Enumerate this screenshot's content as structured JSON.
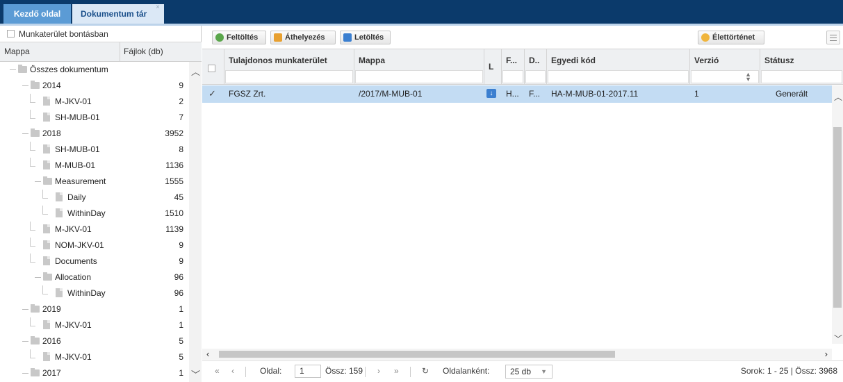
{
  "tabs": {
    "home": "Kezdő oldal",
    "docs": "Dokumentum tár",
    "close_glyph": "×"
  },
  "workspace_toggle": {
    "label": "Munkaterület bontásban",
    "checked": false
  },
  "tree": {
    "col_folder": "Mappa",
    "col_files": "Fájlok (db)",
    "rows": [
      {
        "label": "Összes dokumentum",
        "count": "",
        "type": "folder",
        "depth": 0
      },
      {
        "label": "2014",
        "count": "9",
        "type": "folder",
        "depth": 1
      },
      {
        "label": "M-JKV-01",
        "count": "2",
        "type": "file",
        "depth": 2
      },
      {
        "label": "SH-MUB-01",
        "count": "7",
        "type": "file",
        "depth": 2
      },
      {
        "label": "2018",
        "count": "3952",
        "type": "folder",
        "depth": 1
      },
      {
        "label": "SH-MUB-01",
        "count": "8",
        "type": "file",
        "depth": 2
      },
      {
        "label": "M-MUB-01",
        "count": "1136",
        "type": "file",
        "depth": 2
      },
      {
        "label": "Measurement",
        "count": "1555",
        "type": "folder",
        "depth": 2
      },
      {
        "label": "Daily",
        "count": "45",
        "type": "file",
        "depth": 3
      },
      {
        "label": "WithinDay",
        "count": "1510",
        "type": "file",
        "depth": 3
      },
      {
        "label": "M-JKV-01",
        "count": "1139",
        "type": "file",
        "depth": 2
      },
      {
        "label": "NOM-JKV-01",
        "count": "9",
        "type": "file",
        "depth": 2
      },
      {
        "label": "Documents",
        "count": "9",
        "type": "file",
        "depth": 2
      },
      {
        "label": "Allocation",
        "count": "96",
        "type": "folder",
        "depth": 2
      },
      {
        "label": "WithinDay",
        "count": "96",
        "type": "file",
        "depth": 3
      },
      {
        "label": "2019",
        "count": "1",
        "type": "folder",
        "depth": 1
      },
      {
        "label": "M-JKV-01",
        "count": "1",
        "type": "file",
        "depth": 2
      },
      {
        "label": "2016",
        "count": "5",
        "type": "folder",
        "depth": 1
      },
      {
        "label": "M-JKV-01",
        "count": "5",
        "type": "file",
        "depth": 2
      },
      {
        "label": "2017",
        "count": "1",
        "type": "folder",
        "depth": 1
      }
    ]
  },
  "toolbar": {
    "upload": "Feltöltés",
    "move": "Áthelyezés",
    "download": "Letöltés",
    "history": "Élettörténet"
  },
  "grid": {
    "columns": {
      "owner": "Tulajdonos munkaterület",
      "folder": "Mappa",
      "l": "L",
      "f": "F...",
      "d": "D..",
      "code": "Egyedi kód",
      "version": "Verzió",
      "status": "Státusz"
    },
    "rows": [
      {
        "selected": true,
        "owner": "FGSZ Zrt.",
        "folder": "/2017/M-MUB-01",
        "f": "H...",
        "d": "F...",
        "code": "HA-M-MUB-01-2017.11",
        "version": "1",
        "status": "Generált"
      }
    ]
  },
  "pager": {
    "page_label": "Oldal:",
    "page_value": "1",
    "total_pages": "Össz: 159",
    "per_page_label": "Oldalanként:",
    "per_page_value": "25 db",
    "summary": "Sorok: 1 - 25 | Össz: 3968"
  },
  "colors": {
    "topbar": "#0b3a6b",
    "selected_row": "#c3dcf3",
    "active_tab": "#dbe8f6",
    "home_tab": "#5b9bd5"
  },
  "icons": [
    "upload-icon",
    "move-icon",
    "download-icon",
    "history-icon",
    "menu-icon",
    "folder-icon",
    "file-icon"
  ]
}
